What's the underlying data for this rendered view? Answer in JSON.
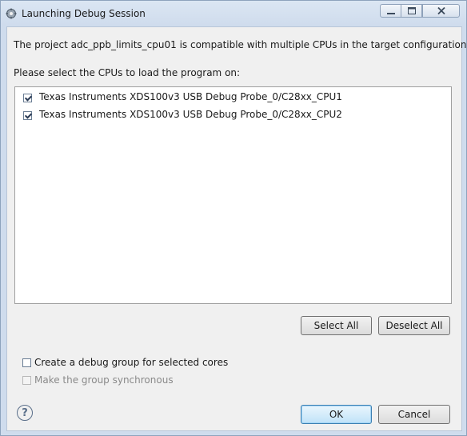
{
  "window": {
    "title": "Launching Debug Session",
    "icon": "debug-gear-icon"
  },
  "controls": {
    "minimize_icon": "minimize-icon",
    "maximize_icon": "maximize-icon",
    "close_icon": "close-icon"
  },
  "message": "The project adc_ppb_limits_cpu01 is compatible with multiple CPUs in the target configuration.",
  "instruction": "Please select the CPUs to load the program on:",
  "cpus": [
    {
      "label": "Texas Instruments XDS100v3 USB Debug Probe_0/C28xx_CPU1",
      "checked": true
    },
    {
      "label": "Texas Instruments XDS100v3 USB Debug Probe_0/C28xx_CPU2",
      "checked": true
    }
  ],
  "buttons": {
    "select_all": "Select All",
    "deselect_all": "Deselect All",
    "ok": "OK",
    "cancel": "Cancel"
  },
  "options": {
    "debug_group": {
      "label": "Create a debug group for selected cores",
      "checked": false
    },
    "synchronous": {
      "label": "Make the group synchronous",
      "checked": false,
      "enabled": false
    }
  },
  "help_icon": "help-icon"
}
